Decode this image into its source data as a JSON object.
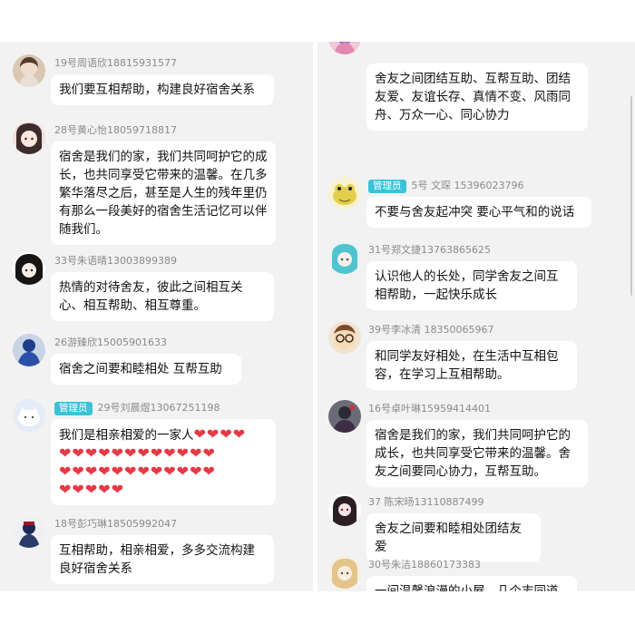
{
  "left": [
    {
      "sender": "19号周语欣18815931577",
      "text": "我们要互相帮助，构建良好宿舍关系",
      "avatar": "girl-photo-avatar"
    },
    {
      "sender": "28号黄心怡18059718817",
      "text": "宿舍是我们的家，我们共同呵护它的成长，也共同享受它带来的温馨。在几多繁华落尽之后，甚至是人生的残年里仍有那么一段美好的宿舍生活记忆可以伴随我们。",
      "avatar": "anime-girl-avatar"
    },
    {
      "sender": "33号朱语晴13003899389",
      "text": "热情的对待舍友，彼此之间相互关心、相互帮助、相互尊重。",
      "avatar": "dark-hair-avatar"
    },
    {
      "sender": "26游臻欣15005901633",
      "text": "宿舍之间要和睦相处 互帮互助",
      "avatar": "blue-figure-avatar"
    },
    {
      "badge": "管理员",
      "sender": "29号刘晨煜13067251198",
      "text": "我们是相亲相爱的一家人",
      "hearts_line1": "❤❤❤❤",
      "hearts_rows": [
        "❤❤❤❤❤❤❤❤❤❤❤❤",
        "❤❤❤❤❤❤❤❤❤❤❤❤",
        "❤❤❤❤❤"
      ],
      "avatar": "white-cat-avatar"
    },
    {
      "sender": "18号彭巧琳18505992047",
      "text": "互相帮助，相亲相爱，多多交流构建良好宿舍关系",
      "avatar": "character-avatar"
    }
  ],
  "right": [
    {
      "sender": "",
      "text": "舍友之间团结互助、互帮互助、团结友爱、友谊长存、真情不变、风雨同舟、万众一心、同心协力",
      "avatar": "pink-avatar"
    },
    {
      "badge": "管理员",
      "sender": "5号 文琛 15396023796",
      "text": "不要与舍友起冲突 要心平气和的说话",
      "avatar": "yellow-frog-avatar"
    },
    {
      "sender": "31号郑文捷13763865625",
      "text": "认识他人的长处，同学舍友之间互相帮助，一起快乐成长",
      "avatar": "teal-hair-avatar"
    },
    {
      "sender": "39号李冰清 18350065967",
      "text": "和同学友好相处，在生活中互相包容，在学习上互相帮助。",
      "avatar": "glasses-avatar"
    },
    {
      "sender": "16号卓叶琳15959414401",
      "text": "宿舍是我们的家，我们共同呵护它的成长，也共同享受它带来的温馨。舍友之间要同心协力，互帮互助。",
      "avatar": "dark-photo-avatar"
    },
    {
      "sender": "37 陈宋旸13110887499",
      "text": "舍友之间要和睦相处团结友爱",
      "avatar": "gothic-girl-avatar"
    },
    {
      "sender": "30号朱洁18860173383",
      "text": "一间温馨浪漫的小屋，几个志同道合的人，组成了我们求学生活中珍贵的回忆",
      "avatar": "blonde-girl-avatar"
    }
  ],
  "colors": {
    "background": "#f2f2f2",
    "bubble": "#ffffff",
    "admin_badge": "#39c2d8",
    "sender_text": "#8a8a8a",
    "heart": "#e63946"
  }
}
